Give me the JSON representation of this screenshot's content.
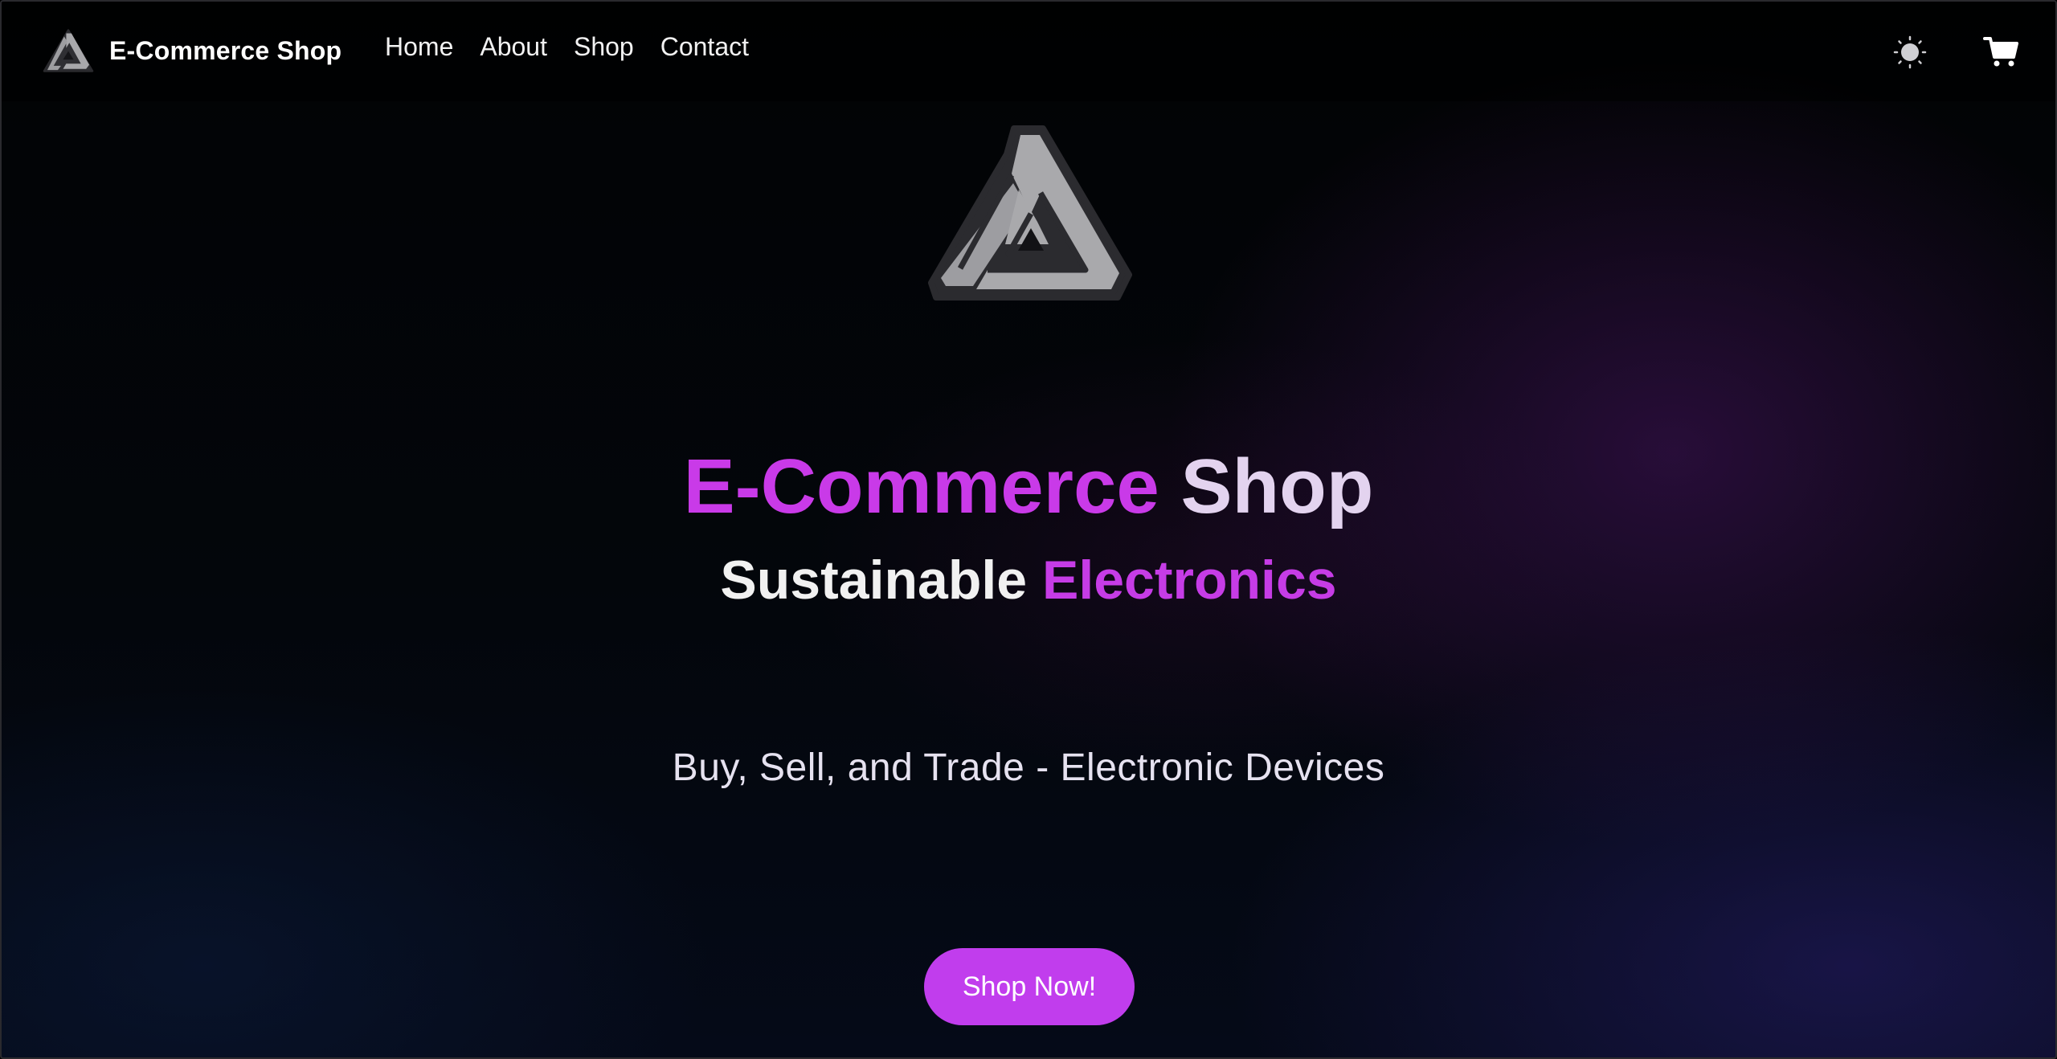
{
  "navbar": {
    "brand_name": "E-Commerce Shop",
    "links": [
      {
        "label": "Home"
      },
      {
        "label": "About"
      },
      {
        "label": "Shop"
      },
      {
        "label": "Contact"
      }
    ],
    "theme_toggle_icon": "sun-icon",
    "cart_icon": "cart-icon"
  },
  "hero": {
    "title_accent": "E-Commerce",
    "title_plain": "Shop",
    "subtitle_plain": "Sustainable",
    "subtitle_accent": "Electronics",
    "tagline": "Buy, Sell, and Trade - Electronic Devices",
    "cta_label": "Shop Now!"
  },
  "colors": {
    "accent": "#c93ae8",
    "button": "#c13ded",
    "title_light": "#e3d3ef",
    "background": "#02040a"
  }
}
